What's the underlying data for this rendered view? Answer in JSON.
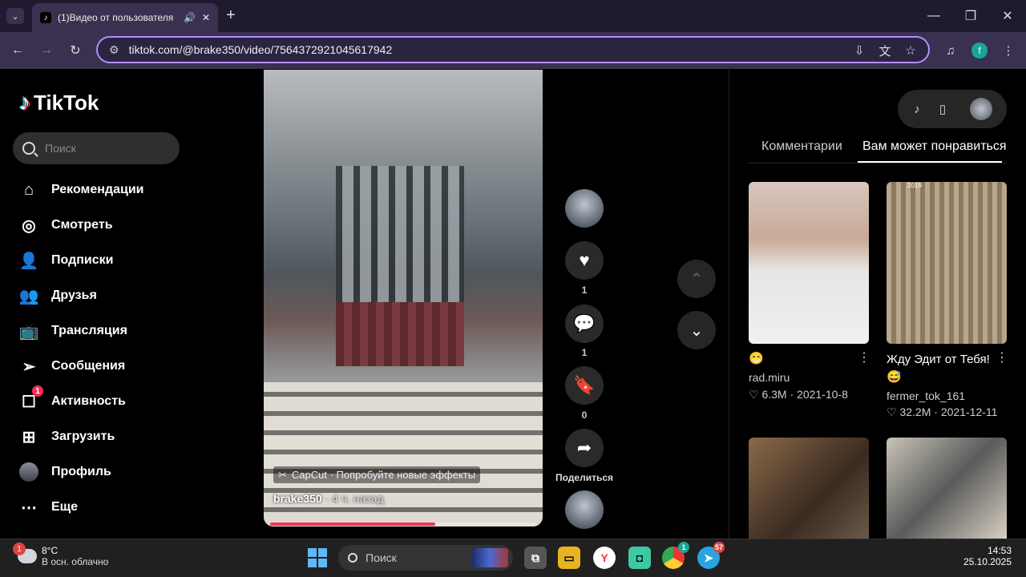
{
  "browser": {
    "tab_title": "(1)Видео от пользователя",
    "url": "tiktok.com/@brake350/video/7564372921045617942",
    "profile_initial": "f"
  },
  "sidebar": {
    "logo_text": "TikTok",
    "search_placeholder": "Поиск",
    "items": [
      {
        "label": "Рекомендации",
        "icon": "home-icon"
      },
      {
        "label": "Смотреть",
        "icon": "compass-icon"
      },
      {
        "label": "Подписки",
        "icon": "following-icon"
      },
      {
        "label": "Друзья",
        "icon": "friends-icon"
      },
      {
        "label": "Трансляция",
        "icon": "live-icon"
      },
      {
        "label": "Сообщения",
        "icon": "messages-icon"
      },
      {
        "label": "Активность",
        "icon": "activity-icon",
        "badge": "1"
      },
      {
        "label": "Загрузить",
        "icon": "upload-icon"
      },
      {
        "label": "Профиль",
        "icon": "profile-avatar"
      },
      {
        "label": "Еще",
        "icon": "more-icon"
      }
    ]
  },
  "video": {
    "capcut": "CapCut · Попробуйте новые эффекты",
    "author": "brake350",
    "time": " · 4 ч. назад",
    "progress": 0.62
  },
  "actions": {
    "likes": "1",
    "comments": "1",
    "saves": "0",
    "share_label": "Поделиться"
  },
  "right": {
    "tabs": [
      "Комментарии",
      "Вам может понравиться"
    ],
    "cards": [
      {
        "title": "😁",
        "user": "rad.miru",
        "likes": "6.3M",
        "date": "2021-10-8"
      },
      {
        "title": "Жду Эдит от Тебя! 😅",
        "user": "fermer_tok_161",
        "likes": "32.2M",
        "date": "2021-12-11"
      }
    ],
    "thumb_caption": "2019"
  },
  "taskbar": {
    "temp": "8°C",
    "condition": "В осн. облачно",
    "weather_badge": "1",
    "search": "Поиск",
    "chrome_badge": "1",
    "telegram_badge": "57",
    "time": "14:53",
    "date": "25.10.2025"
  },
  "colors": {
    "accent": "#fe2c55",
    "url_border": "#b48cff"
  }
}
